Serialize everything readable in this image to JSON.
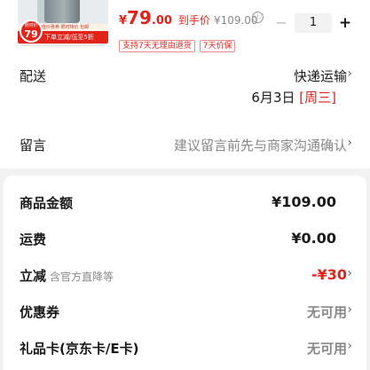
{
  "product": {
    "badge_top": "限时价",
    "badge_price": "79",
    "promo_strip": "超值价惠券 限时特价 包邮",
    "promo_bar": "下单立减/低至5折",
    "price_symbol": "¥",
    "price_int": "79",
    "price_dec": ".00",
    "final_label": "到手价",
    "final_value": "¥109.00",
    "info_icon": "ⓘ",
    "quantity": "1",
    "minus": "−",
    "plus": "+",
    "tags": [
      "支持7天无理由退货",
      "7天价保"
    ]
  },
  "delivery": {
    "label": "配送",
    "method": "快递运输",
    "date": "6月3日",
    "weekday": "[周三]"
  },
  "message": {
    "label": "留言",
    "placeholder": "建议留言前先与商家沟通确认"
  },
  "summary": {
    "goods_amount_label": "商品金额",
    "goods_amount_value": "¥109.00",
    "shipping_label": "运费",
    "shipping_value": "¥0.00",
    "discount_label": "立减",
    "discount_note": "含官方直降等",
    "discount_value": "-¥30",
    "coupon_label": "优惠券",
    "coupon_value": "无可用",
    "giftcard_label": "礼品卡(京东卡/E卡)",
    "giftcard_value": "无可用"
  },
  "icons": {
    "chevron": "›"
  },
  "colors": {
    "accent": "#e2231a",
    "muted": "#888888"
  }
}
